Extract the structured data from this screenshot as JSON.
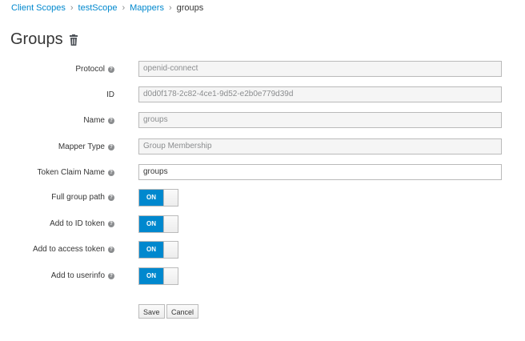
{
  "breadcrumb": {
    "items": [
      "Client Scopes",
      "testScope",
      "Mappers"
    ],
    "current": "groups"
  },
  "title": "Groups",
  "fields": {
    "protocol": {
      "label": "Protocol",
      "value": "openid-connect"
    },
    "id": {
      "label": "ID",
      "value": "d0d0f178-2c82-4ce1-9d52-e2b0e779d39d"
    },
    "name": {
      "label": "Name",
      "value": "groups"
    },
    "mapper_type": {
      "label": "Mapper Type",
      "value": "Group Membership"
    },
    "token_claim_name": {
      "label": "Token Claim Name",
      "value": "groups"
    }
  },
  "toggles": {
    "full_group_path": {
      "label": "Full group path",
      "state": "ON"
    },
    "add_to_id_token": {
      "label": "Add to ID token",
      "state": "ON"
    },
    "add_to_access_token": {
      "label": "Add to access token",
      "state": "ON"
    },
    "add_to_userinfo": {
      "label": "Add to userinfo",
      "state": "ON"
    }
  },
  "help_glyph": "?",
  "buttons": {
    "save": "Save",
    "cancel": "Cancel"
  },
  "colors": {
    "accent": "#0088ce",
    "text": "#363636",
    "muted": "#8b8d8f"
  }
}
